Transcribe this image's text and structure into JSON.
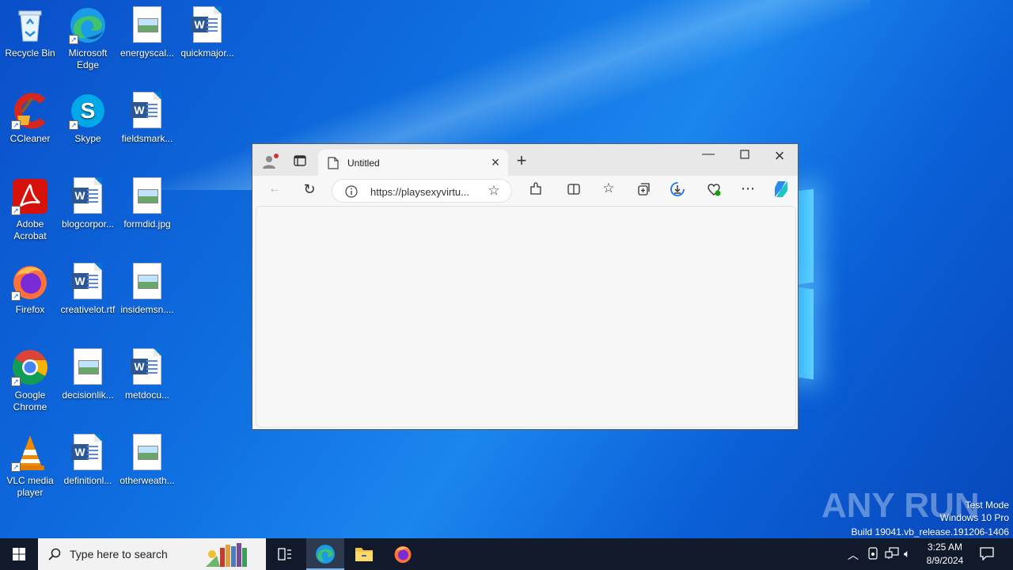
{
  "desktop": {
    "icons": [
      {
        "label": "Recycle Bin",
        "kind": "recycle"
      },
      {
        "label": "Microsoft Edge",
        "kind": "edge"
      },
      {
        "label": "energyscal...",
        "kind": "image-file"
      },
      {
        "label": "quickmajor...",
        "kind": "word-file"
      },
      {
        "label": "CCleaner",
        "kind": "ccleaner"
      },
      {
        "label": "Skype",
        "kind": "skype"
      },
      {
        "label": "fieldsmark...",
        "kind": "word-file"
      },
      {
        "label": "Adobe Acrobat",
        "kind": "acrobat"
      },
      {
        "label": "blogcorpor...",
        "kind": "word-file"
      },
      {
        "label": "formdid.jpg",
        "kind": "image-file"
      },
      {
        "label": "Firefox",
        "kind": "firefox"
      },
      {
        "label": "creativelot.rtf",
        "kind": "word-file"
      },
      {
        "label": "insidemsn....",
        "kind": "image-file"
      },
      {
        "label": "Google Chrome",
        "kind": "chrome"
      },
      {
        "label": "decisionlik...",
        "kind": "image-file"
      },
      {
        "label": "metdocu...",
        "kind": "word-file"
      },
      {
        "label": "VLC media player",
        "kind": "vlc"
      },
      {
        "label": "definitionl...",
        "kind": "word-file"
      },
      {
        "label": "otherweath...",
        "kind": "image-file"
      }
    ]
  },
  "browser": {
    "tab_title": "Untitled",
    "address": "https://playsexyvirtu...",
    "new_tab_symbol": "+",
    "more_symbol": "⋯"
  },
  "taskbar": {
    "search_placeholder": "Type here to search",
    "time": "3:25 AM",
    "date": "8/9/2024"
  },
  "watermark": {
    "logo": "ANY RUN",
    "line1": "Test Mode",
    "line2": "Windows 10 Pro",
    "line3": "Build 19041.vb_release.191206-1406"
  }
}
